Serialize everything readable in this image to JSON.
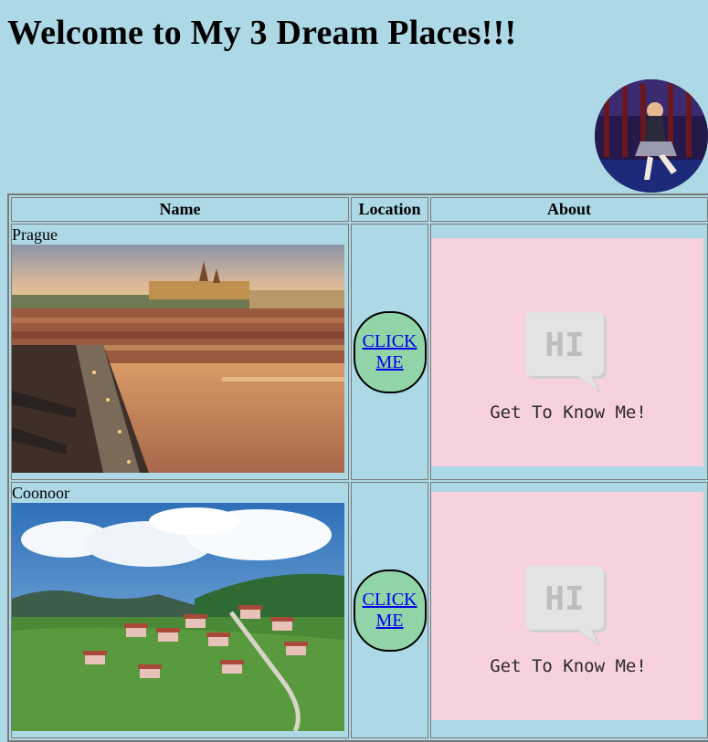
{
  "page": {
    "title": "Welcome to My 3 Dream Places!!!"
  },
  "table": {
    "headers": {
      "name": "Name",
      "location": "Location",
      "about": "About"
    },
    "rows": [
      {
        "name": "Prague",
        "link_label": "CLICK ME",
        "about_line1": "HI",
        "about_line2": "Get To Know Me!"
      },
      {
        "name": "Coonoor",
        "link_label": "CLICK ME",
        "about_line1": "HI",
        "about_line2": "Get To Know Me!"
      }
    ]
  },
  "colors": {
    "background": "#add8e6",
    "button_fill": "#90d4a8",
    "link": "#0000ee",
    "about_bg": "#f7d1dd"
  },
  "icons": {
    "avatar": "profile-photo-dancer"
  }
}
